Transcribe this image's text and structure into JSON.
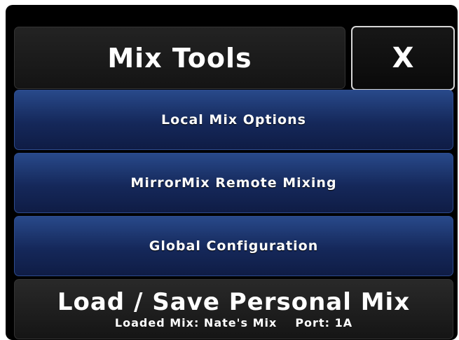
{
  "header": {
    "title": "Mix Tools",
    "close_label": "X"
  },
  "menu": {
    "local_mix_options": "Local Mix Options",
    "mirrormix_remote": "MirrorMix Remote Mixing",
    "global_configuration": "Global Configuration"
  },
  "load_save": {
    "title": "Load / Save Personal Mix",
    "loaded_mix_label": "Loaded Mix:",
    "loaded_mix_value": "Nate's Mix",
    "port_label": "Port:",
    "port_value": "1A"
  },
  "colors": {
    "background": "#000000",
    "button_blue": "#1a2f66",
    "button_dark": "#1c1c1c",
    "text": "#ffffff"
  }
}
